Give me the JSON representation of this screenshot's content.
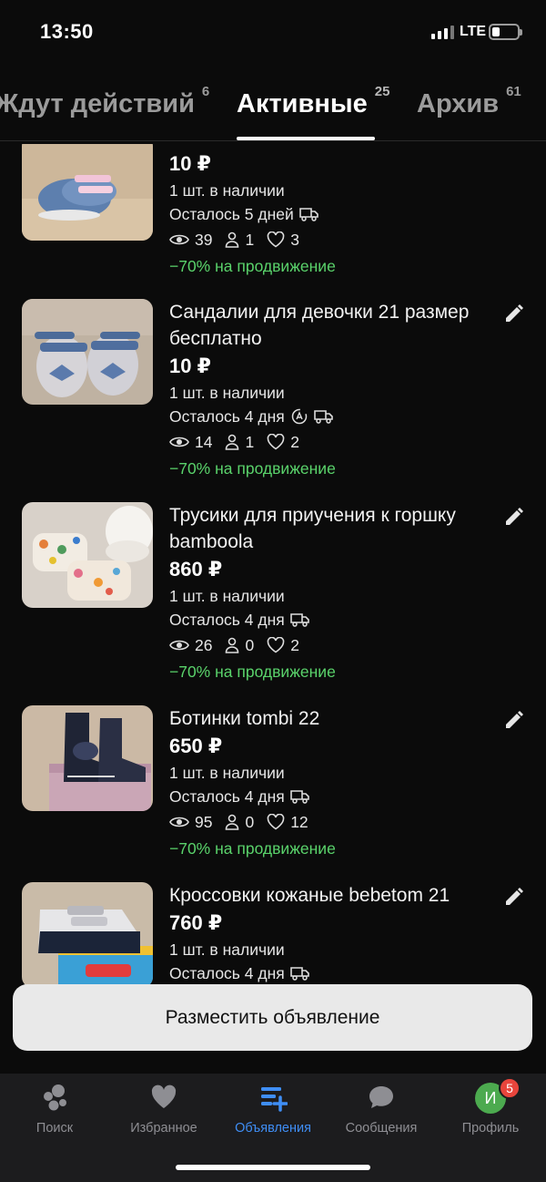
{
  "status_bar": {
    "time": "13:50",
    "network": "LTE"
  },
  "tabs": [
    {
      "label": "Ждут действий",
      "count": "6",
      "active": false
    },
    {
      "label": "Активные",
      "count": "25",
      "active": true
    },
    {
      "label": "Архив",
      "count": "61",
      "active": false
    }
  ],
  "items": [
    {
      "title": "",
      "price": "10 ₽",
      "stock": "1 шт. в наличии",
      "remaining": "Осталось 5 дней",
      "views": "39",
      "contacts": "1",
      "favorites": "3",
      "promo": "−70% на продвижение",
      "thumb": "blue-sneakers"
    },
    {
      "title": "Сандалии для девочки 21 размер бесплатно",
      "price": "10 ₽",
      "stock": "1 шт. в наличии",
      "remaining": "Осталось 4 дня",
      "views": "14",
      "contacts": "1",
      "favorites": "2",
      "promo": "−70% на продвижение",
      "thumb": "sandals"
    },
    {
      "title": "Трусики для приучения к горшку bamboola",
      "price": "860 ₽",
      "stock": "1 шт. в наличии",
      "remaining": "Осталось 4 дня",
      "views": "26",
      "contacts": "0",
      "favorites": "2",
      "promo": "−70% на продвижение",
      "thumb": "diapers"
    },
    {
      "title": "Ботинки tombi 22",
      "price": "650 ₽",
      "stock": "1 шт. в наличии",
      "remaining": "Осталось 4 дня",
      "views": "95",
      "contacts": "0",
      "favorites": "12",
      "promo": "−70% на продвижение",
      "thumb": "boots"
    },
    {
      "title": "Кроссовки кожаные bebetom 21",
      "price": "760 ₽",
      "stock": "1 шт. в наличии",
      "remaining": "Осталось 4 дня",
      "thumb": "sneakers-box"
    }
  ],
  "post_button": "Разместить объявление",
  "bottom_nav": [
    {
      "label": "Поиск",
      "icon": "search-dots-icon",
      "active": false
    },
    {
      "label": "Избранное",
      "icon": "heart-icon",
      "active": false
    },
    {
      "label": "Объявления",
      "icon": "listings-add-icon",
      "active": true
    },
    {
      "label": "Сообщения",
      "icon": "chat-bubble-icon",
      "active": false
    },
    {
      "label": "Профиль",
      "icon": "avatar",
      "active": false,
      "avatar_letter": "И",
      "badge": "5"
    }
  ],
  "colors": {
    "accent": "#3f8ef5",
    "promo": "#5ad36b",
    "badge": "#e8453c",
    "avatar": "#4caa4f"
  }
}
